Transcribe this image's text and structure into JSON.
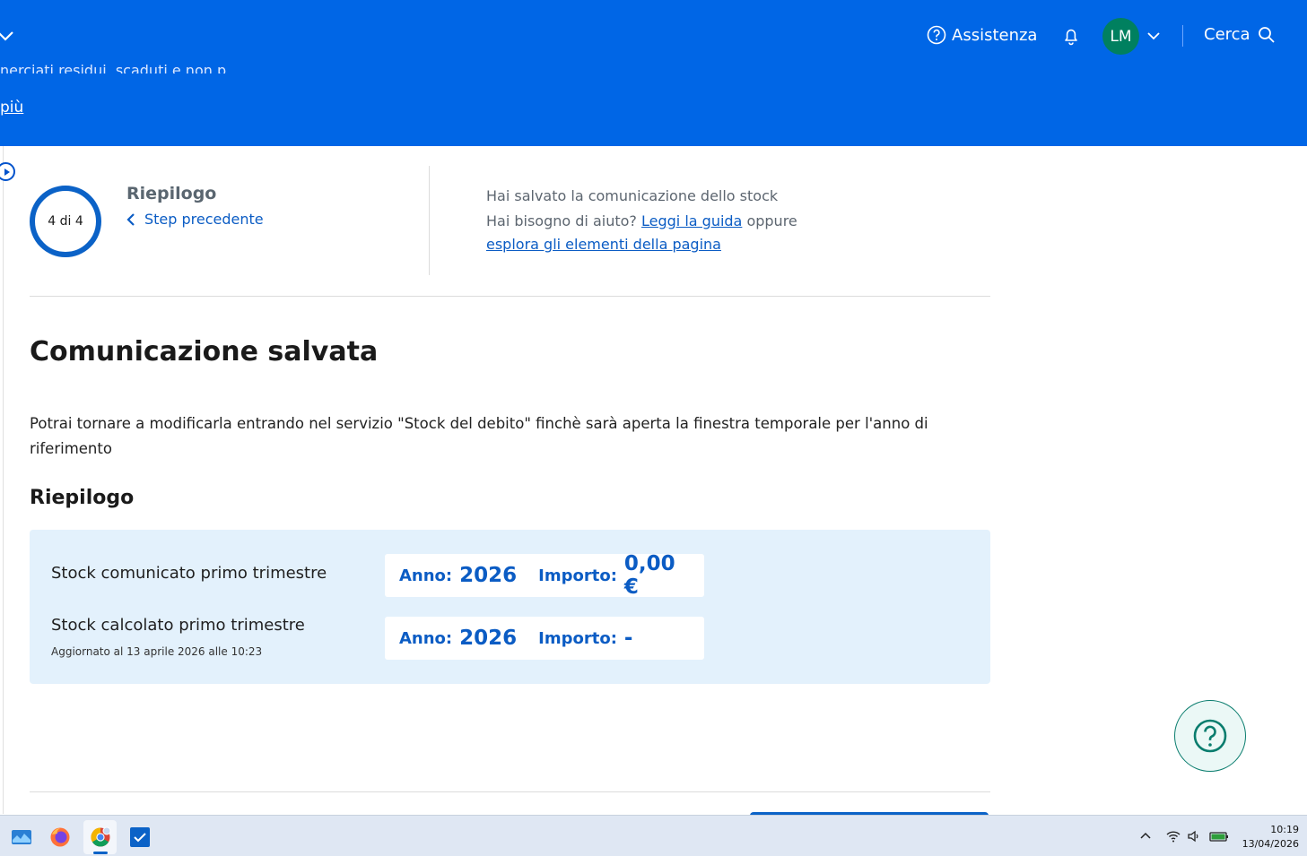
{
  "header": {
    "sub_text": "nerciati residui, scaduti e non p...",
    "more_link": "più",
    "assist_label": "Assistenza",
    "avatar_initials": "LM",
    "search_label": "Cerca"
  },
  "stepper": {
    "progress_text": "4 di 4",
    "progress_fraction": 1.0,
    "title": "Riepilogo",
    "prev_label": "Step precedente"
  },
  "help": {
    "saved_text": "Hai salvato la comunicazione dello stock",
    "question": "Hai bisogno di aiuto?",
    "guide_link": "Leggi la guida",
    "or": "oppure",
    "explore_link": "esplora gli elementi della pagina"
  },
  "main": {
    "title": "Comunicazione salvata",
    "description": "Potrai tornare a modificarla entrando nel servizio \"Stock del debito\" finchè sarà aperta la finestra temporale per l'anno di riferimento",
    "section_title": "Riepilogo"
  },
  "summary": {
    "rows": [
      {
        "label": "Stock comunicato primo trimestre",
        "year_key": "Anno:",
        "year": "2026",
        "amount_key": "Importo:",
        "amount": "0,00 €"
      },
      {
        "label": "Stock calcolato primo trimestre",
        "note": "Aggiornato al 13 aprile 2026 alle 10:23",
        "year_key": "Anno:",
        "year": "2026",
        "amount_key": "Importo:",
        "amount": "-"
      }
    ]
  },
  "fab": {
    "icon": "help-circle-icon"
  },
  "taskbar": {
    "time": "10:19",
    "date": "13/04/2026"
  },
  "colors": {
    "brand": "#0066e6",
    "link": "#0b5cc4",
    "avatar": "#00805f",
    "summary_bg": "#e3f1fc",
    "fab_border": "#0a7d6e"
  }
}
